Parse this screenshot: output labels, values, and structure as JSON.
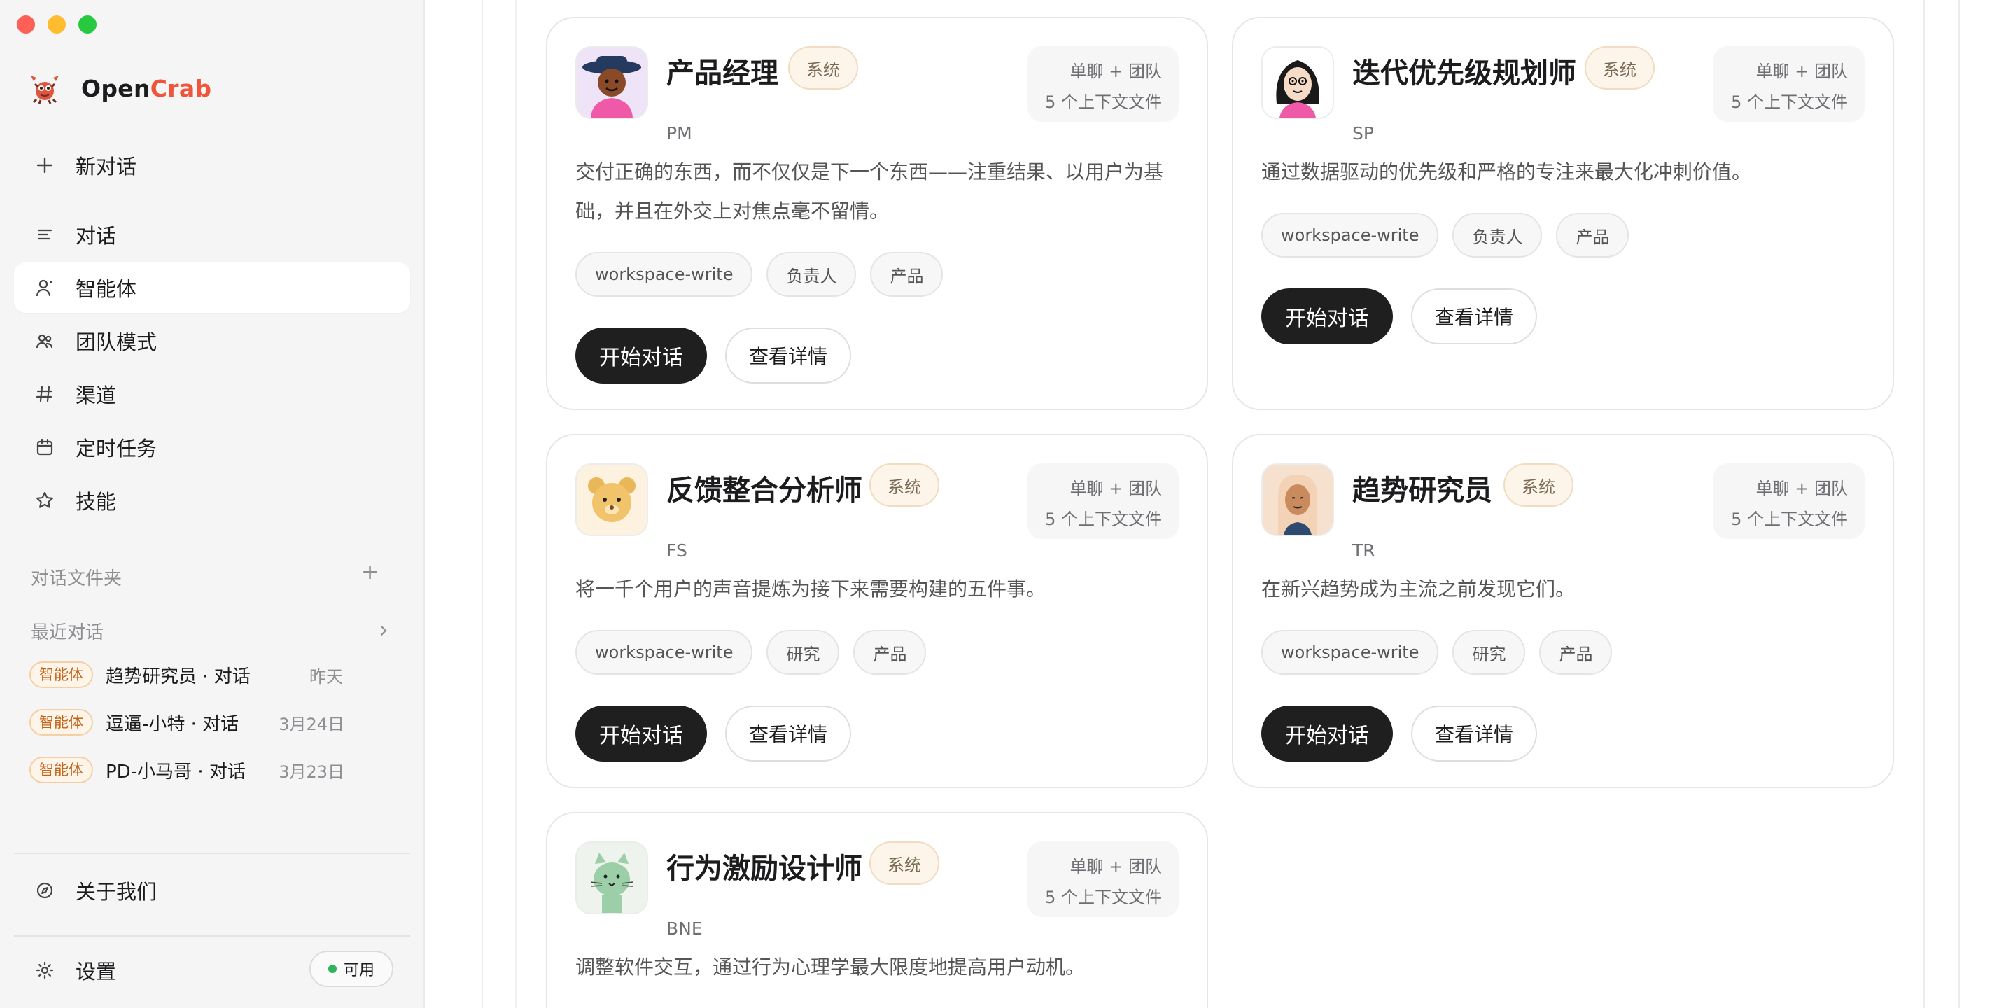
{
  "app": {
    "brand_part1": "Open",
    "brand_part2": "Crab",
    "accent_color": "#f0543a"
  },
  "sidebar": {
    "new_chat": "新对话",
    "nav": [
      {
        "label": "对话",
        "icon": "list-icon"
      },
      {
        "label": "智能体",
        "icon": "user-icon",
        "active": true
      },
      {
        "label": "团队模式",
        "icon": "team-icon"
      },
      {
        "label": "渠道",
        "icon": "hash-icon"
      },
      {
        "label": "定时任务",
        "icon": "calendar-icon"
      },
      {
        "label": "技能",
        "icon": "star-icon"
      }
    ],
    "folders_label": "对话文件夹",
    "folders_add": "+",
    "recent_label": "最近对话",
    "recent": [
      {
        "badge": "智能体",
        "title": "趋势研究员 · 对话",
        "date": "昨天"
      },
      {
        "badge": "智能体",
        "title": "逗逼-小特 · 对话",
        "date": "3月24日"
      },
      {
        "badge": "智能体",
        "title": "PD-小马哥 · 对话",
        "date": "3月23日"
      }
    ],
    "about": "关于我们",
    "settings": "设置",
    "status": "可用"
  },
  "agents": [
    {
      "name": "产品经理",
      "badge": "系统",
      "code": "PM",
      "meta1": "单聊 + 团队",
      "meta2": "5 个上下文文件",
      "desc": "交付正确的东西，而不仅仅是下一个东西——注重结果、以用户为基础，并且在外交上对焦点毫不留情。",
      "tags": [
        "workspace-write",
        "负责人",
        "产品"
      ],
      "primary": "开始对话",
      "secondary": "查看详情"
    },
    {
      "name": "迭代优先级规划师",
      "badge": "系统",
      "code": "SP",
      "meta1": "单聊 + 团队",
      "meta2": "5 个上下文文件",
      "desc": "通过数据驱动的优先级和严格的专注来最大化冲刺价值。",
      "tags": [
        "workspace-write",
        "负责人",
        "产品"
      ],
      "primary": "开始对话",
      "secondary": "查看详情"
    },
    {
      "name": "反馈整合分析师",
      "badge": "系统",
      "code": "FS",
      "meta1": "单聊 + 团队",
      "meta2": "5 个上下文文件",
      "desc": "将一千个用户的声音提炼为接下来需要构建的五件事。",
      "tags": [
        "workspace-write",
        "研究",
        "产品"
      ],
      "primary": "开始对话",
      "secondary": "查看详情"
    },
    {
      "name": "趋势研究员",
      "badge": "系统",
      "code": "TR",
      "meta1": "单聊 + 团队",
      "meta2": "5 个上下文文件",
      "desc": "在新兴趋势成为主流之前发现它们。",
      "tags": [
        "workspace-write",
        "研究",
        "产品"
      ],
      "primary": "开始对话",
      "secondary": "查看详情"
    },
    {
      "name": "行为激励设计师",
      "badge": "系统",
      "code": "BNE",
      "meta1": "单聊 + 团队",
      "meta2": "5 个上下文文件",
      "desc": "调整软件交互，通过行为心理学最大限度地提高用户动机。",
      "tags": [],
      "primary": "",
      "secondary": ""
    }
  ]
}
